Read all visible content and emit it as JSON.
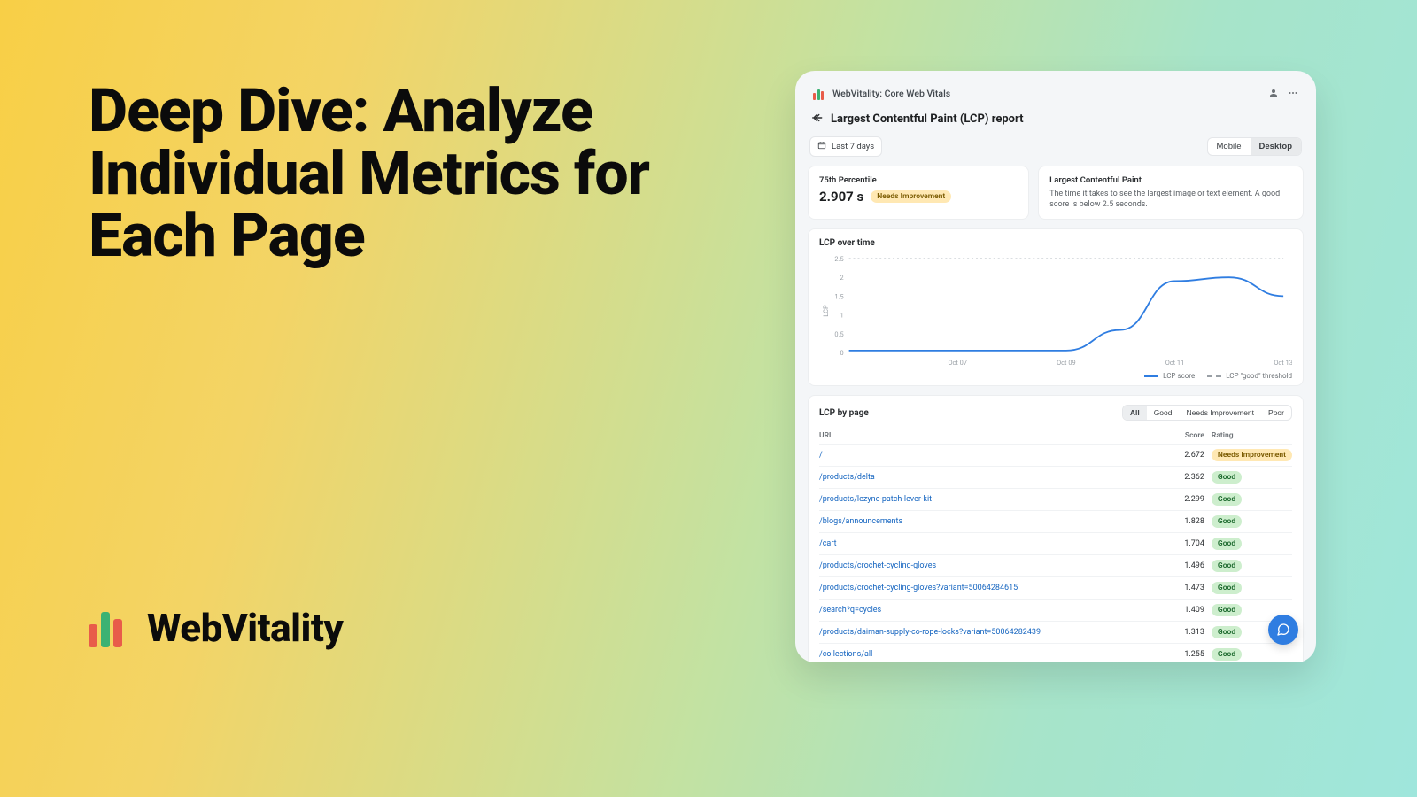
{
  "hero": {
    "headline": "Deep Dive: Analyze Individual Metrics for Each Page",
    "brand": "WebVitality"
  },
  "window": {
    "title": "WebVitality: Core Web Vitals",
    "report_title": "Largest Contentful Paint (LCP) report",
    "date_filter": "Last 7 days",
    "device_segment": {
      "options": [
        "Mobile",
        "Desktop"
      ],
      "active": "Desktop"
    },
    "percentile_card": {
      "label": "75th Percentile",
      "value": "2.907 s",
      "rating": "Needs Improvement"
    },
    "info_card": {
      "label": "Largest Contentful Paint",
      "desc": "The time it takes to see the largest image or text element. A good score is below 2.5 seconds."
    },
    "chart": {
      "title": "LCP over time",
      "legend_score": "LCP score",
      "legend_threshold": "LCP \"good\" threshold"
    },
    "table": {
      "title": "LCP by page",
      "filters": [
        "All",
        "Good",
        "Needs Improvement",
        "Poor"
      ],
      "active_filter": "All",
      "col_url": "URL",
      "col_score": "Score",
      "col_rating": "Rating",
      "rows": [
        {
          "url": "/",
          "score": "2.672",
          "rating": "Needs Improvement",
          "rating_class": "ni"
        },
        {
          "url": "/products/delta",
          "score": "2.362",
          "rating": "Good",
          "rating_class": "good"
        },
        {
          "url": "/products/lezyne-patch-lever-kit",
          "score": "2.299",
          "rating": "Good",
          "rating_class": "good"
        },
        {
          "url": "/blogs/announcements",
          "score": "1.828",
          "rating": "Good",
          "rating_class": "good"
        },
        {
          "url": "/cart",
          "score": "1.704",
          "rating": "Good",
          "rating_class": "good"
        },
        {
          "url": "/products/crochet-cycling-gloves",
          "score": "1.496",
          "rating": "Good",
          "rating_class": "good"
        },
        {
          "url": "/products/crochet-cycling-gloves?variant=50064284615",
          "score": "1.473",
          "rating": "Good",
          "rating_class": "good"
        },
        {
          "url": "/search?q=cycles",
          "score": "1.409",
          "rating": "Good",
          "rating_class": "good"
        },
        {
          "url": "/products/daiman-supply-co-rope-locks?variant=50064282439",
          "score": "1.313",
          "rating": "Good",
          "rating_class": "good"
        },
        {
          "url": "/collections/all",
          "score": "1.255",
          "rating": "Good",
          "rating_class": "good"
        }
      ]
    }
  },
  "chart_data": {
    "type": "line",
    "title": "LCP over time",
    "xlabel": "",
    "ylabel": "LCP",
    "ylim": [
      0,
      2.5
    ],
    "x_ticks": [
      "Oct 07",
      "Oct 09",
      "Oct 11",
      "Oct 13"
    ],
    "y_ticks": [
      0,
      0.5,
      1,
      1.5,
      2,
      2.5
    ],
    "threshold": 2.5,
    "series": [
      {
        "name": "LCP score",
        "x": [
          "Oct 05",
          "Oct 06",
          "Oct 07",
          "Oct 08",
          "Oct 09",
          "Oct 10",
          "Oct 11",
          "Oct 12",
          "Oct 13"
        ],
        "values": [
          0.05,
          0.05,
          0.05,
          0.05,
          0.05,
          0.6,
          1.9,
          2.0,
          1.5
        ]
      }
    ]
  }
}
